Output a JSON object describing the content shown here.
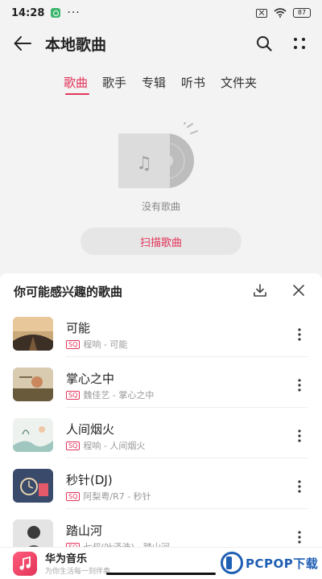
{
  "status_bar": {
    "time": "14:28",
    "battery": "87"
  },
  "header": {
    "title": "本地歌曲"
  },
  "tabs": [
    {
      "label": "歌曲",
      "active": true
    },
    {
      "label": "歌手",
      "active": false
    },
    {
      "label": "专辑",
      "active": false
    },
    {
      "label": "听书",
      "active": false
    },
    {
      "label": "文件夹",
      "active": false
    }
  ],
  "empty_state": {
    "message": "没有歌曲",
    "scan_label": "扫描歌曲"
  },
  "recommend": {
    "title": "你可能感兴趣的歌曲",
    "songs": [
      {
        "title": "可能",
        "badge": "SQ",
        "subtitle": "程响 - 可能"
      },
      {
        "title": "掌心之中",
        "badge": "SQ",
        "subtitle": "魏佳艺 - 掌心之中"
      },
      {
        "title": "人间烟火",
        "badge": "SQ",
        "subtitle": "程响 - 人间烟火"
      },
      {
        "title": "秒针(DJ)",
        "badge": "SQ",
        "subtitle": "阿梨粤/R7 - 秒针"
      },
      {
        "title": "踏山河",
        "badge": "SQ",
        "subtitle": "七叔(叶泽浩) - 踏山河"
      }
    ]
  },
  "bottom_bar": {
    "app_name": "华为音乐",
    "slogan": "为你生活每一刻伴奏"
  },
  "watermark": {
    "brand": "PCPOP下载"
  },
  "colors": {
    "accent": "#e2345a",
    "background": "#f3f3f3",
    "panel": "#ffffff"
  }
}
